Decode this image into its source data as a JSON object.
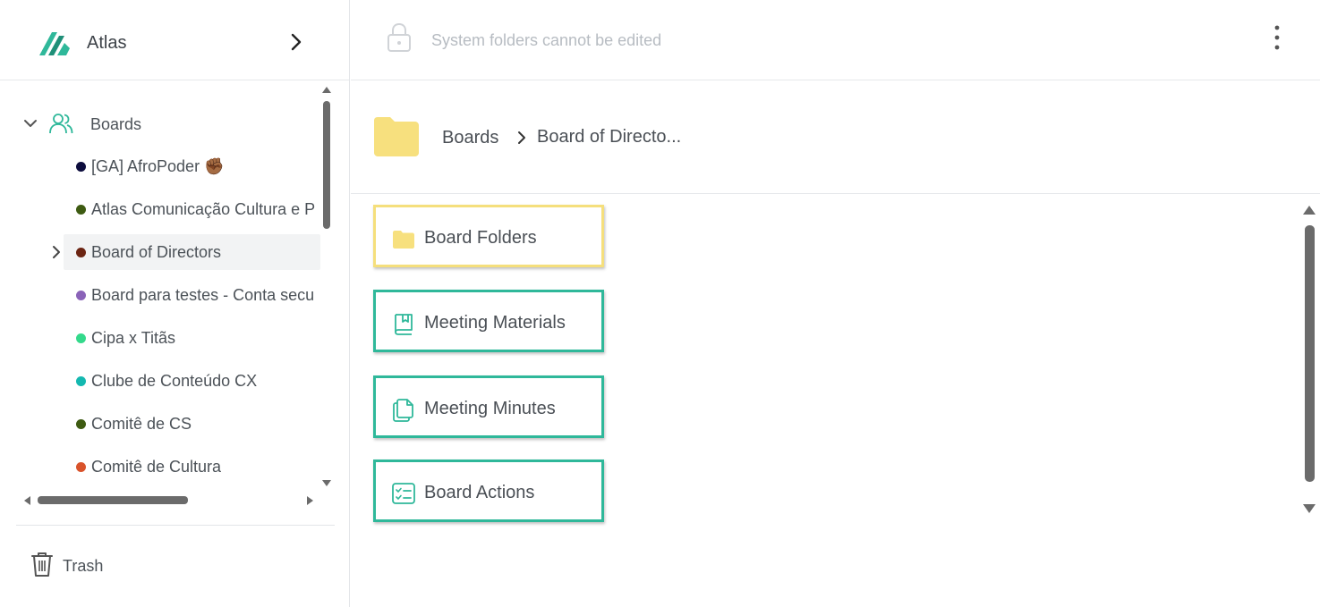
{
  "brand": {
    "name": "Atlas",
    "accent": "#2fb89a"
  },
  "tree": {
    "root_label": "Boards",
    "items": [
      {
        "label": "[GA] AfroPoder ✊🏾",
        "color": "#0d0d3d"
      },
      {
        "label": "Atlas Comunicação Cultura e P",
        "color": "#3e5b12"
      },
      {
        "label": "Board of Directors",
        "color": "#6b2412",
        "selected": true
      },
      {
        "label": "Board para testes - Conta secu",
        "color": "#8a63b8"
      },
      {
        "label": "Cipa x Titãs",
        "color": "#34d98b"
      },
      {
        "label": "Clube de Conteúdo CX",
        "color": "#14b8b0"
      },
      {
        "label": "Comitê de CS",
        "color": "#3e5b12"
      },
      {
        "label": "Comitê de Cultura",
        "color": "#d9532b"
      }
    ]
  },
  "sidebar_footer": {
    "trash_label": "Trash"
  },
  "topbar": {
    "message": "System folders cannot be edited"
  },
  "breadcrumb": {
    "root": "Boards",
    "current": "Board of Directo..."
  },
  "cards": [
    {
      "label": "Board Folders",
      "icon": "folder-icon"
    },
    {
      "label": "Meeting Materials",
      "icon": "book-icon"
    },
    {
      "label": "Meeting Minutes",
      "icon": "documents-icon"
    },
    {
      "label": "Board Actions",
      "icon": "checklist-icon"
    }
  ]
}
